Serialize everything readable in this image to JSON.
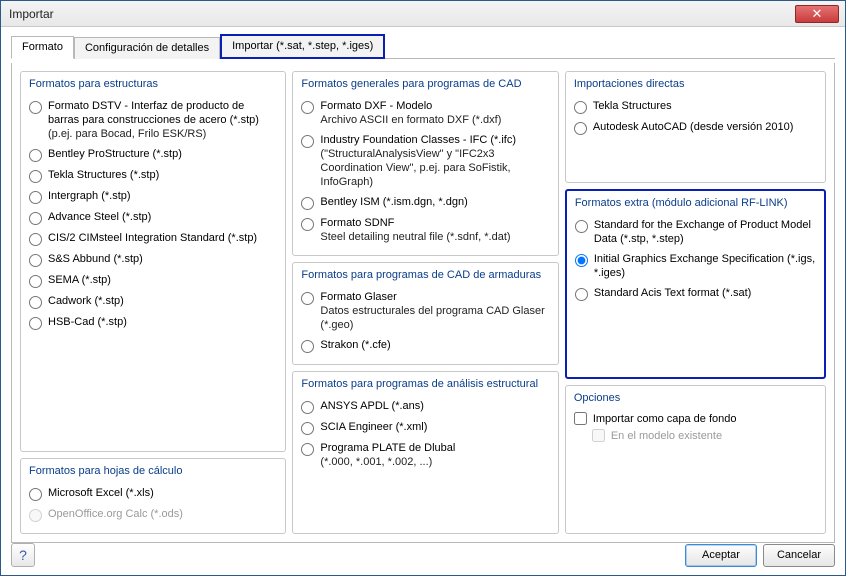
{
  "window": {
    "title": "Importar",
    "close_icon": "✕"
  },
  "tabs": [
    {
      "label": "Formato",
      "active": true
    },
    {
      "label": "Configuración de detalles",
      "active": false
    },
    {
      "label": "Importar  (*.sat, *.step, *.iges)",
      "active": false,
      "highlighted": true
    }
  ],
  "groups": {
    "estructuras": {
      "title": "Formatos para estructuras",
      "items": [
        {
          "label": "Formato DSTV - Interfaz de producto de barras para construcciones de acero (*.stp)",
          "sub": "(p.ej. para Bocad, Frilo ESK/RS)"
        },
        {
          "label": "Bentley ProStructure (*.stp)"
        },
        {
          "label": "Tekla Structures (*.stp)"
        },
        {
          "label": "Intergraph (*.stp)"
        },
        {
          "label": "Advance Steel (*.stp)"
        },
        {
          "label": "CIS/2 CIMsteel Integration Standard (*.stp)"
        },
        {
          "label": "S&S Abbund (*.stp)"
        },
        {
          "label": "SEMA (*.stp)"
        },
        {
          "label": "Cadwork (*.stp)"
        },
        {
          "label": "HSB-Cad (*.stp)"
        }
      ]
    },
    "hojas": {
      "title": "Formatos para hojas de cálculo",
      "items": [
        {
          "label": "Microsoft Excel (*.xls)"
        },
        {
          "label": "OpenOffice.org Calc (*.ods)",
          "disabled": true
        }
      ]
    },
    "cad_general": {
      "title": "Formatos generales para programas de CAD",
      "items": [
        {
          "label": "Formato DXF - Modelo",
          "sub": "Archivo ASCII en formato DXF (*.dxf)"
        },
        {
          "label": "Industry Foundation Classes - IFC (*.ifc)",
          "sub": "(\"StructuralAnalysisView\" y \"IFC2x3 Coordination View\", p.ej. para SoFistik, InfoGraph)"
        },
        {
          "label": "Bentley ISM (*.ism.dgn, *.dgn)"
        },
        {
          "label": "Formato SDNF",
          "sub": "Steel detailing neutral file (*.sdnf, *.dat)"
        }
      ]
    },
    "cad_armaduras": {
      "title": "Formatos para programas de CAD de armaduras",
      "items": [
        {
          "label": "Formato Glaser",
          "sub": "Datos estructurales del programa CAD Glaser (*.geo)"
        },
        {
          "label": "Strakon (*.cfe)"
        }
      ]
    },
    "analisis": {
      "title": "Formatos para programas de análisis estructural",
      "items": [
        {
          "label": "ANSYS APDL (*.ans)"
        },
        {
          "label": "SCIA Engineer (*.xml)"
        },
        {
          "label": "Programa PLATE de Dlubal",
          "sub": "(*.000, *.001, *.002, ...)"
        }
      ]
    },
    "directas": {
      "title": "Importaciones directas",
      "items": [
        {
          "label": "Tekla Structures"
        },
        {
          "label": "Autodesk AutoCAD (desde versión 2010)"
        }
      ]
    },
    "extra": {
      "title": "Formatos extra (módulo adicional RF-LINK)",
      "highlighted": true,
      "items": [
        {
          "label": "Standard for the Exchange of Product Model Data (*.stp, *.step)"
        },
        {
          "label": "Initial Graphics Exchange Specification (*.igs, *.iges)",
          "selected": true
        },
        {
          "label": "Standard Acis Text format (*.sat)"
        }
      ]
    },
    "opciones": {
      "title": "Opciones",
      "check1": "Importar como capa de fondo",
      "check2": "En el modelo existente"
    }
  },
  "footer": {
    "help_icon": "?",
    "accept": "Aceptar",
    "cancel": "Cancelar"
  }
}
